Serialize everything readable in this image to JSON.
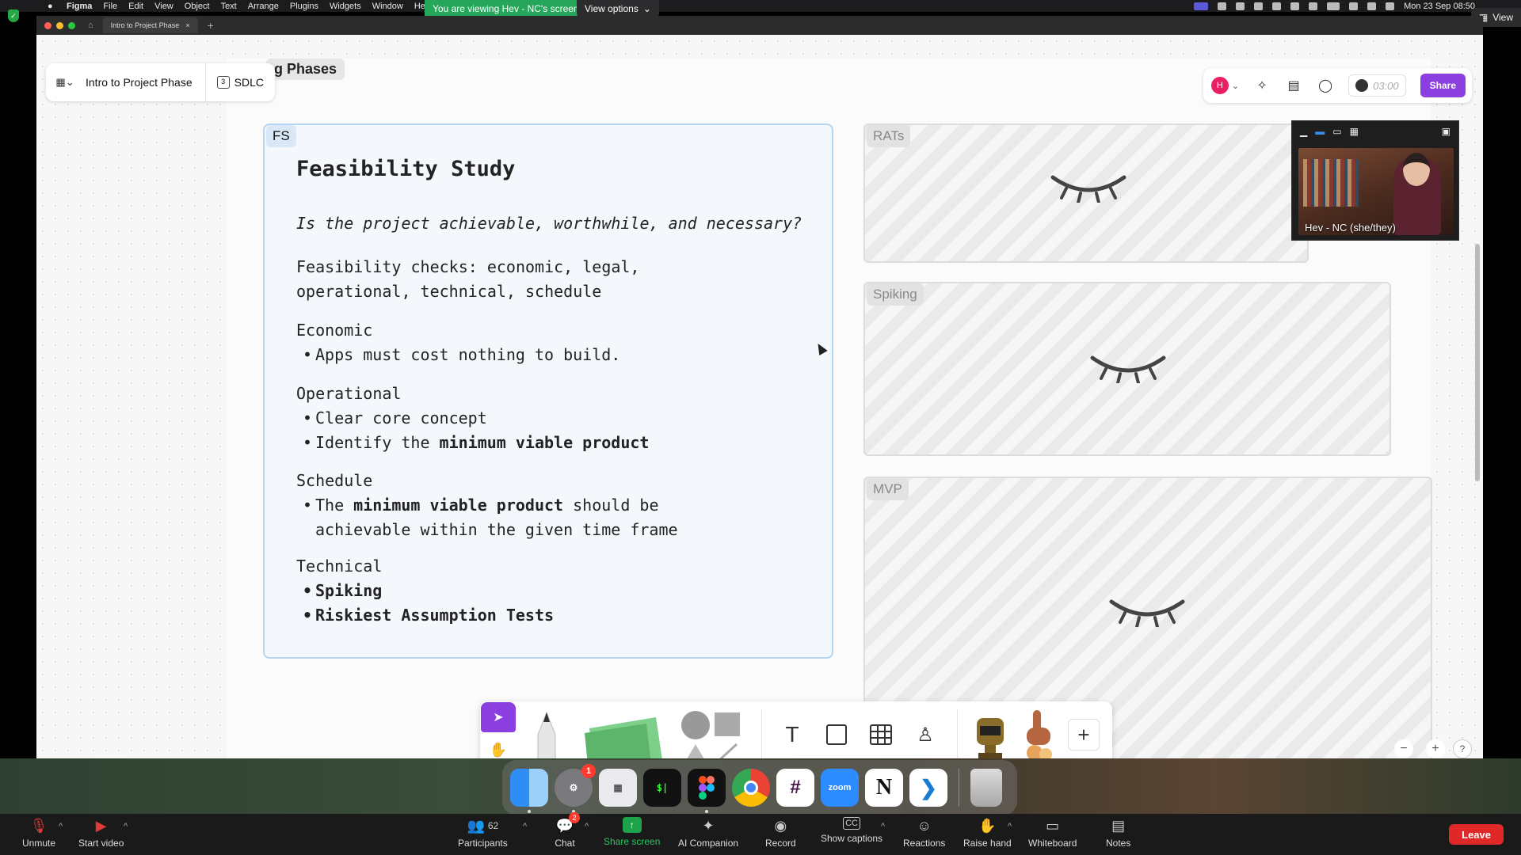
{
  "menubar": {
    "apple": "",
    "app_name": "Figma",
    "menus": [
      "File",
      "Edit",
      "View",
      "Object",
      "Text",
      "Arrange",
      "Plugins",
      "Widgets",
      "Window",
      "Help"
    ],
    "clock": "Mon 23 Sep 08:50"
  },
  "sharing": {
    "banner": "You are viewing Hev - NC's screen",
    "view_options": "View options",
    "view_button": "View"
  },
  "figma": {
    "tab_title": "Intro to Project Phase",
    "file_name": "Intro to Project Phase",
    "page_name": "SDLC",
    "section_title": "g Phases",
    "avatar_initial": "H",
    "timer": "03:00",
    "share_label": "Share"
  },
  "fs_card": {
    "badge": "FS",
    "title": "Feasibility Study",
    "question": "Is the project achievable, worthwhile, and necessary?",
    "checks_line1": "Feasibility checks: economic, legal,",
    "checks_line2": "operational, technical, schedule",
    "economic_heading": "Economic",
    "economic_items": [
      "Apps must cost nothing to build."
    ],
    "operational_heading": "Operational",
    "operational_item1": "Clear core concept",
    "operational_item2_prefix": "Identify the ",
    "operational_item2_bold": "minimum viable product",
    "schedule_heading": "Schedule",
    "schedule_prefix": "The ",
    "schedule_bold": "minimum viable product",
    "schedule_rest1": " should be",
    "schedule_rest2": "achievable within the given time frame",
    "technical_heading": "Technical",
    "technical_item1": "Spiking",
    "technical_item2": "Riskiest Assumption Tests"
  },
  "sections": [
    {
      "label": "RATs"
    },
    {
      "label": "Spiking"
    },
    {
      "label": "MVP"
    }
  ],
  "video": {
    "participant_name": "Hev - NC (she/they)"
  },
  "dock": {
    "apps": [
      "Finder",
      "System Settings",
      "Launchpad",
      "Terminal",
      "Figma",
      "Chrome",
      "Slack",
      "zoom",
      "Notion",
      "VS Code",
      "Trash"
    ],
    "settings_badge": "1",
    "zoom_label": "zoom",
    "notion_label": "N",
    "terminal_label": "$|"
  },
  "zoom_bar": {
    "unmute": "Unmute",
    "start_video": "Start video",
    "participants": "Participants",
    "participants_count": "62",
    "chat": "Chat",
    "chat_badge": "2",
    "share_screen": "Share screen",
    "ai_companion": "AI Companion",
    "record": "Record",
    "show_captions": "Show captions",
    "reactions": "Reactions",
    "raise_hand": "Raise hand",
    "whiteboard": "Whiteboard",
    "notes": "Notes",
    "leave": "Leave"
  }
}
